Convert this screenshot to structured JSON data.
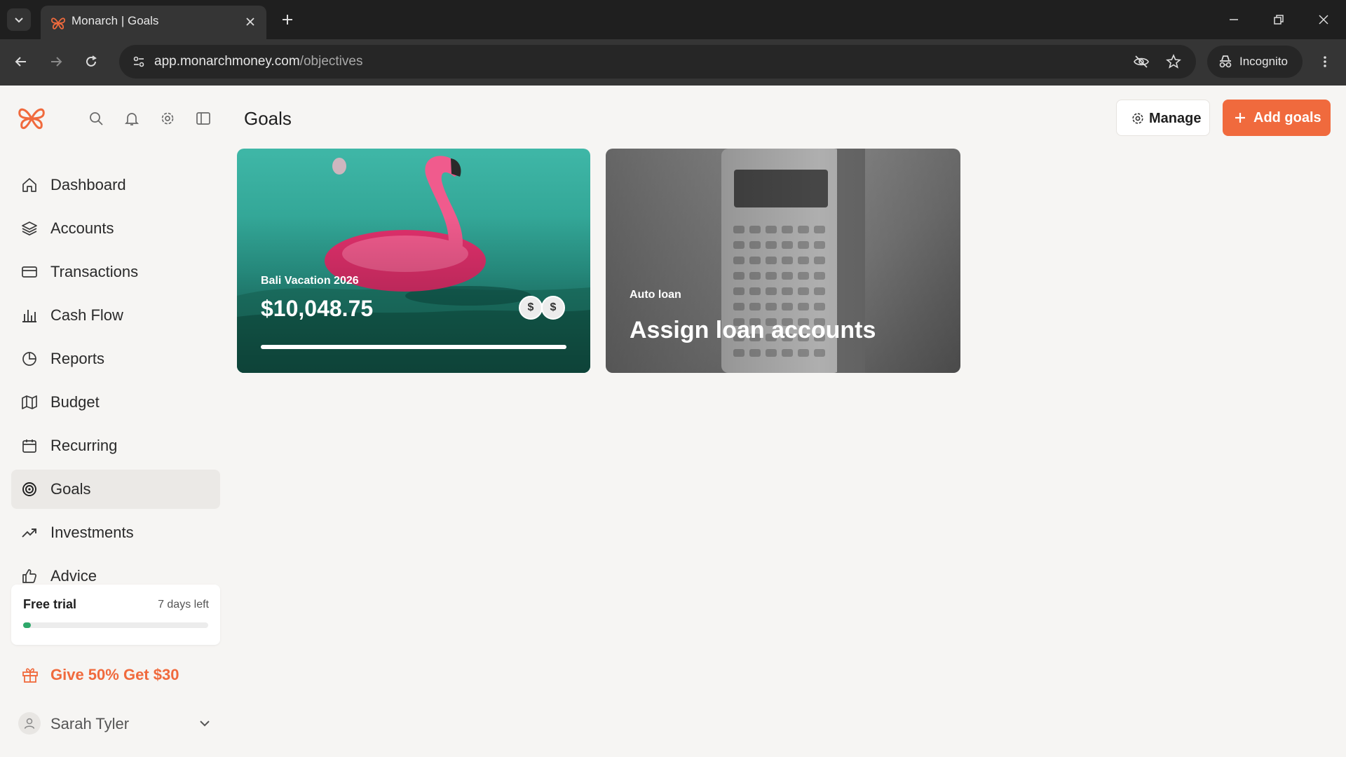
{
  "browser": {
    "tab_title": "Monarch | Goals",
    "url_host": "app.monarchmoney.com",
    "url_path": "/objectives",
    "incognito_label": "Incognito"
  },
  "sidebar": {
    "items": [
      {
        "label": "Dashboard",
        "icon": "home-icon"
      },
      {
        "label": "Accounts",
        "icon": "layers-icon"
      },
      {
        "label": "Transactions",
        "icon": "credit-card-icon"
      },
      {
        "label": "Cash Flow",
        "icon": "bar-chart-icon"
      },
      {
        "label": "Reports",
        "icon": "pie-chart-icon"
      },
      {
        "label": "Budget",
        "icon": "map-icon"
      },
      {
        "label": "Recurring",
        "icon": "calendar-icon"
      },
      {
        "label": "Goals",
        "icon": "target-icon",
        "active": true
      },
      {
        "label": "Investments",
        "icon": "trending-up-icon"
      },
      {
        "label": "Advice",
        "icon": "thumbs-up-icon"
      }
    ],
    "trial": {
      "title": "Free trial",
      "days_left": "7 days left",
      "progress": 0.03
    },
    "referral": "Give 50% Get $30",
    "user": {
      "name": "Sarah Tyler"
    }
  },
  "main": {
    "title": "Goals",
    "manage_label": "Manage",
    "add_goals_label": "Add goals",
    "goals": [
      {
        "name": "Bali Vacation 2026",
        "amount": "$10,048.75",
        "progress": 1.0,
        "coin_symbol": "$"
      },
      {
        "category": "Auto loan",
        "action": "Assign loan accounts"
      }
    ]
  },
  "colors": {
    "accent": "#f06a3d",
    "trial_progress": "#2ea86a",
    "active_nav_bg": "#ebe9e6"
  }
}
